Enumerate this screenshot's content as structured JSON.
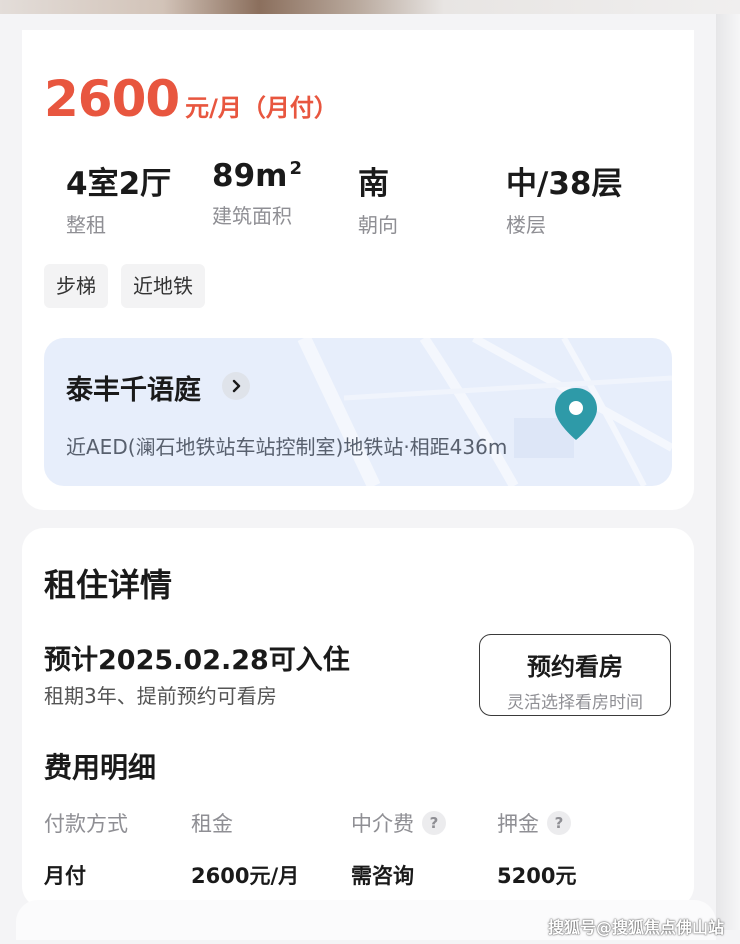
{
  "price": {
    "amount": "2600",
    "unit": "元/月（月付）"
  },
  "specs": [
    {
      "value": "4室2厅",
      "label": "整租"
    },
    {
      "value": "89m",
      "sup": "2",
      "label": "建筑面积"
    },
    {
      "value": "南",
      "label": "朝向"
    },
    {
      "value": "中/38层",
      "label": "楼层"
    }
  ],
  "tags": [
    "步梯",
    "近地铁"
  ],
  "location": {
    "community": "泰丰千语庭",
    "metro": "近AED(澜石地铁站车站控制室)地铁站·相距436m",
    "icons": {
      "chevron": "chevron-right-icon",
      "pin": "map-pin-icon"
    },
    "pin_color": "#2e9aa8"
  },
  "rental": {
    "title": "租住详情",
    "move_in": "预计2025.02.28可入住",
    "lease_note": "租期3年、提前预约可看房",
    "visit_button": {
      "label": "预约看房",
      "sub": "灵活选择看房时间"
    }
  },
  "fees": {
    "title": "费用明细",
    "columns": [
      "付款方式",
      "租金",
      "中介费",
      "押金"
    ],
    "values": [
      "月付",
      "2600元/月",
      "需咨询",
      "5200元"
    ],
    "help_icon_text": "?"
  },
  "watermark": "搜狐号@搜狐焦点佛山站",
  "colors": {
    "price": "#e8563f",
    "map_bg": "#e7eefb",
    "tag_bg": "#f3f3f4"
  }
}
